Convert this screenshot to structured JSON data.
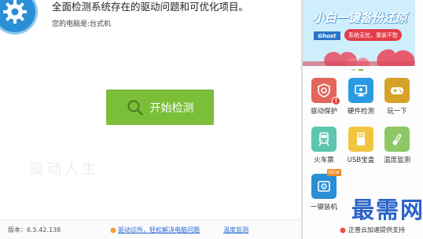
{
  "header": {
    "headline": "全面检测系统存在的驱动问题和可优化项目。",
    "computer_type": "您的电脑是:台式机"
  },
  "main": {
    "start_button": "开始检测",
    "watermark": "驱动人生"
  },
  "footer": {
    "version": "版本：6.5.42.138",
    "link_driver_diagnosis": "驱动诊所，轻松解决电脑问题",
    "link_temperature": "温度监测"
  },
  "sidebar": {
    "banner": {
      "title": "小白一键备份还原",
      "ghost_label": "Ghost",
      "subtitle": "系统无忧，重装不愁"
    },
    "carousel": {
      "count": 2,
      "active_index": 1
    },
    "tools": [
      {
        "label": "驱动保护",
        "icon": "shield-gear-icon",
        "color": "#e2665c"
      },
      {
        "label": "硬件检测",
        "icon": "monitor-icon",
        "color": "#2a9be0"
      },
      {
        "label": "玩一下",
        "icon": "gamepad-icon",
        "color": "#d6a22a"
      },
      {
        "label": "火车票",
        "icon": "train-icon",
        "color": "#5cc6b0"
      },
      {
        "label": "USB宝盒",
        "icon": "usb-icon",
        "color": "#f0c640"
      },
      {
        "label": "温度监测",
        "icon": "thermometer-icon",
        "color": "#8dc865"
      },
      {
        "label": "一键装机",
        "icon": "disk-install-icon",
        "color": "#2a8fd6",
        "badge": "NEW"
      }
    ],
    "brand_watermark": "最需网",
    "support_text": "正普云加速提供支持"
  },
  "colors": {
    "primary_green": "#7bbf38",
    "brand_blue": "#2a8fd6",
    "link_blue": "#2a6bd6"
  }
}
